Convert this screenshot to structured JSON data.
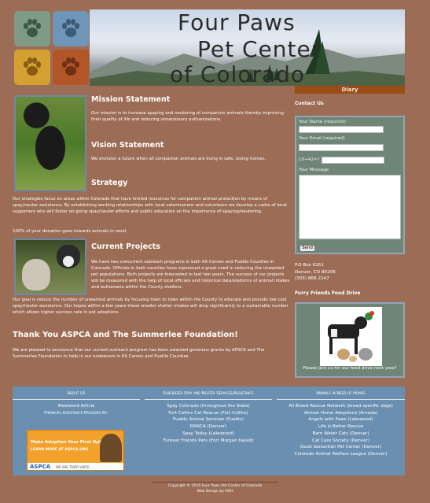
{
  "header": {
    "title_line1": "Four Paws",
    "title_line2": "Pet Center",
    "title_line3": "of Colorado",
    "diary_label": "Diary"
  },
  "main": {
    "mission": {
      "heading": "Mission Statement",
      "text": "Our mission is to increase spaying and neutering of companion animals thereby improving their quality of life and reducing unnecessary euthanizations."
    },
    "vision": {
      "heading": "Vision Statement",
      "text": "We envision a future when all companion animals are living in safe, loving homes."
    },
    "strategy": {
      "heading": "Strategy",
      "text": "Our strategies focus on areas within Colorado that have limited resources for companion animal protection by means of spay/neuter assistance. By establishing working relationships with local veterinarians and volunteers we develop a cadre of local supporters who will foster on-going spay/neuter efforts and public education on the importance of spaying/neutering.",
      "donation_note": "100% of your donation goes towards animals in need."
    },
    "current": {
      "heading": "Current Projects",
      "text_part1": "We have two concurrent outreach programs in both Kit Carson and Pueblo Counties in Colorado. Officials in both counties have expressed a great need in reducing the unwanted pet populations. Both projects are forecasted to last two years. The success of our projects will be measured with the help of local officials and historical data/statistics of animal intakes and euthanasia within the County shelters.",
      "text_part2": "Our goal is reduce the number of unwanted animals by focusing town to town within the County to educate and provide low cost spay/neuter assistance. Our hopes within a few years these smaller shelter intakes will drop significantly to a sustainable number which allows higher success rate in pet adoptions."
    },
    "thanks": {
      "heading": "Thank You ASPCA and The Summerlee Foundation!",
      "text": "We are pleased to announce that our current outreach program has been awarded generous grants by APSCA and The Summerlee Foundation to help in our endeavors in Kit Carson and Pueblo Counties."
    }
  },
  "sidebar": {
    "contact_title": "Contact Us",
    "form": {
      "name_label": "Your Name (required)",
      "email_label": "Your Email (required)",
      "captcha_prefix": "10+42=?",
      "message_label": "Your Message",
      "send_label": "Send"
    },
    "address": {
      "line1": "P.O Box 6261",
      "line2": "Denver, CO 80206",
      "line3": "(303) 868-2247"
    },
    "food_drive": {
      "title": "Furry Friends Food Drive",
      "text": "Please join us for our food drive next year!"
    }
  },
  "footer": {
    "col1": {
      "heading": "About Us",
      "items": [
        "Westword Article"
      ],
      "subheading": "Financial Assistance Provided By:",
      "ad_line1": "Make Adoption Your First Option®",
      "ad_line2": "LEARN MORE AT ASPCA.ORG",
      "ad_brand": "ASPCA",
      "ad_tagline": "WE ARE THEIR VOICE."
    },
    "col2": {
      "heading": "Subsidized Spay and Neuter Services/Assistance",
      "items": [
        "Spay Colorado (throughout the State)",
        "Fort Collins Cat Rescue (Fort Collins)",
        "Pueblo Animal Services (Pueblo)",
        "RMACA (Denver)",
        "Spay Today (Lakewood)",
        "Furever Friends Pets (Fort Morgan based)"
      ]
    },
    "col3": {
      "heading": "Animals in Need of Homes",
      "items": [
        "All Breed Rescue Network (breed specific dogs)",
        "Almost Home Adoptions (Arvada)",
        "Angels with Paws (Lakewood)",
        "Life is Better Rescue",
        "Barn Water Cats (Denver)",
        "Cat Care Society (Denver)",
        "Good Samaritan Pet Center (Denver)",
        "Colorado Animal Welfare League (Denver)"
      ]
    },
    "copyright": "Copyright © 2010 Four Paws Pet Center of Colorado",
    "design_credit": "Web Design by HUH"
  },
  "colors": {
    "page_bg": "#9c6c55",
    "panel_bg": "#6f8575",
    "footer_bg": "#6b8fb1",
    "diary_bar": "#9a4d16"
  }
}
